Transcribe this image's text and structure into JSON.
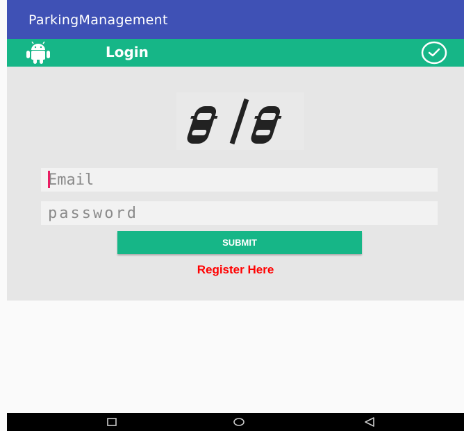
{
  "app_bar": {
    "title": "ParkingManagement",
    "color": "#3f51b5"
  },
  "toolbar": {
    "title": "Login",
    "color": "#16b687",
    "left_icon": "android-icon",
    "right_icon": "check-circle-icon"
  },
  "form": {
    "logo_icon": "two-cars-icon",
    "email_placeholder": "Email",
    "password_placeholder": "password",
    "submit_label": "SUBMIT",
    "register_label": "Register Here",
    "register_color": "#ff0000"
  },
  "navigation": {
    "back_icon": "square-icon",
    "home_icon": "circle-icon",
    "recent_icon": "triangle-back-icon"
  }
}
